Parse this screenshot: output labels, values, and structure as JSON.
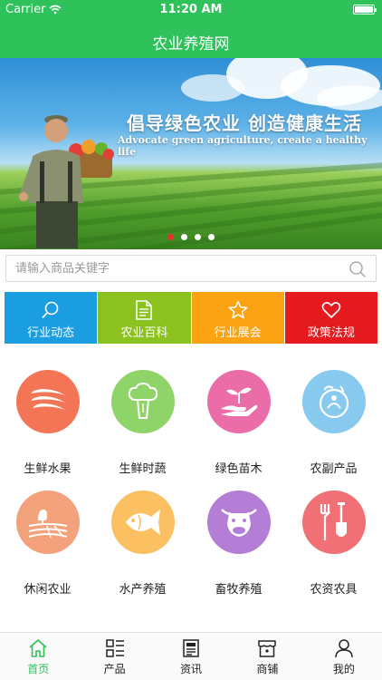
{
  "status_bar": {
    "carrier": "Carrier",
    "time": "11:20 AM"
  },
  "nav": {
    "title": "农业养殖网"
  },
  "banner": {
    "headline": "倡导绿色农业  创造健康生活",
    "subline": "Advocate green agriculture, create a healthy life",
    "slide_count": 4,
    "active_slide": 1
  },
  "search": {
    "placeholder": "请输入商品关键字",
    "value": ""
  },
  "tiles": [
    {
      "label": "行业动态",
      "icon": "search-icon",
      "color": "#1a9de1"
    },
    {
      "label": "农业百科",
      "icon": "document-icon",
      "color": "#8cc21f"
    },
    {
      "label": "行业展会",
      "icon": "star-icon",
      "color": "#fba312"
    },
    {
      "label": "政策法规",
      "icon": "heart-icon",
      "color": "#e51a1e"
    }
  ],
  "grid": [
    {
      "label": "生鲜水果",
      "icon": "banana-icon",
      "color": "#f47555"
    },
    {
      "label": "生鲜时蔬",
      "icon": "broccoli-icon",
      "color": "#8fd468"
    },
    {
      "label": "绿色苗木",
      "icon": "sprout-hand-icon",
      "color": "#ea6da7"
    },
    {
      "label": "农副产品",
      "icon": "food-bowl-icon",
      "color": "#88c9f0"
    },
    {
      "label": "休闲农业",
      "icon": "farm-field-icon",
      "color": "#f3a27c"
    },
    {
      "label": "水产养殖",
      "icon": "fish-icon",
      "color": "#fbc061"
    },
    {
      "label": "畜牧养殖",
      "icon": "cow-icon",
      "color": "#b57ed6"
    },
    {
      "label": "农资农具",
      "icon": "fork-shovel-icon",
      "color": "#f07075"
    }
  ],
  "tabbar": [
    {
      "label": "首页",
      "icon": "home-icon",
      "active": true
    },
    {
      "label": "产品",
      "icon": "grid-list-icon",
      "active": false
    },
    {
      "label": "资讯",
      "icon": "news-icon",
      "active": false
    },
    {
      "label": "商铺",
      "icon": "shop-icon",
      "active": false
    },
    {
      "label": "我的",
      "icon": "user-icon",
      "active": false
    }
  ],
  "colors": {
    "primary": "#2fc25b",
    "active_dot": "#e8312f"
  }
}
